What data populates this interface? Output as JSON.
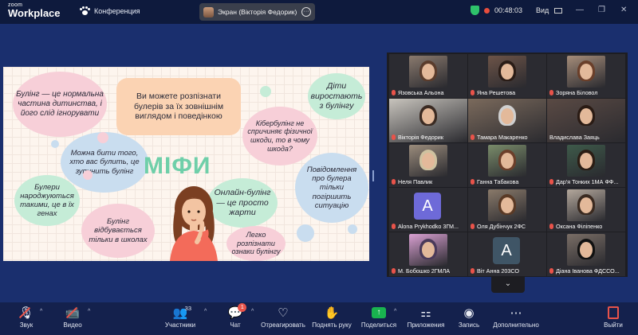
{
  "app": {
    "brand_line1": "zoom",
    "brand_line2": "Workplace",
    "meeting_label": "Конференция"
  },
  "screen_share": {
    "label": "Экран (Вікторія Федорик)",
    "options": "···"
  },
  "status": {
    "timer": "00:48:03",
    "view_label": "Вид"
  },
  "window_controls": {
    "minimize": "—",
    "restore": "❐",
    "close": "✕"
  },
  "slide": {
    "title": "МІФИ",
    "bubbles": {
      "b1": "Булінг — це нормальна частина дитинства, і його слід ігнорувати",
      "b2": "Ви можете розпізнати булерів за їх зовнішнім виглядом і поведінкою",
      "b3": "Діти виростають з булінгу",
      "b4": "Можна бити того, хто вас булить, це зупинить булінг",
      "b5": "Кібербулінг не спричиняє фізичної шкоди, то в чому шкода?",
      "b6": "Булери народжуються такими, це в їх генах",
      "b7": "Онлайн-булінг — це просто жарти",
      "b8": "Повідомлення про булера тільки погіршить ситуацію",
      "b9": "Булінг відбувається тільки в школах",
      "b10": "Легко розпізнати ознаки булінгу"
    }
  },
  "participants": [
    {
      "name": "Язовська Альона",
      "muted": true,
      "type": "video"
    },
    {
      "name": "Яна Решетова",
      "muted": true,
      "type": "video"
    },
    {
      "name": "Зоряна Біловол",
      "muted": true,
      "type": "video"
    },
    {
      "name": "Вікторія Федорик",
      "muted": true,
      "type": "video"
    },
    {
      "name": "Тамара Макаренко",
      "muted": true,
      "type": "video"
    },
    {
      "name": "Владислава Заяць",
      "muted": false,
      "type": "video",
      "active_speaker": true
    },
    {
      "name": "Неля Павлик",
      "muted": true,
      "type": "video"
    },
    {
      "name": "Ганна Табакова",
      "muted": true,
      "type": "video"
    },
    {
      "name": "Дар'я Тонких 1МА ФФ...",
      "muted": true,
      "type": "video"
    },
    {
      "name": "Alona Prykhodko 3ГМ...",
      "muted": true,
      "type": "avatar",
      "letter": "A"
    },
    {
      "name": "Оля Дубінчук 2ФС",
      "muted": true,
      "type": "video"
    },
    {
      "name": "Оксана Філіпенко",
      "muted": true,
      "type": "video"
    },
    {
      "name": "М. Бобошко 2ГМЛА",
      "muted": true,
      "type": "video"
    },
    {
      "name": "Віт Анна 203СО",
      "muted": true,
      "type": "avatar",
      "letter": "A"
    },
    {
      "name": "Діана Іванова ФДССО...",
      "muted": true,
      "type": "video"
    }
  ],
  "gallery_more": "⌄",
  "toolbar": {
    "audio": "Звук",
    "video": "Видео",
    "participants": "Участники",
    "participants_count": "33",
    "chat": "Чат",
    "chat_badge": "1",
    "react": "Отреагировать",
    "raise_hand": "Поднять руку",
    "share": "Поделиться",
    "apps": "Приложения",
    "record": "Запись",
    "more": "Дополнительно",
    "leave": "Выйти"
  },
  "colors": {
    "accent_green": "#2ecc71",
    "leave_red": "#e8534a",
    "share_green": "#19b34f",
    "myths_green": "#6fcfa9"
  }
}
